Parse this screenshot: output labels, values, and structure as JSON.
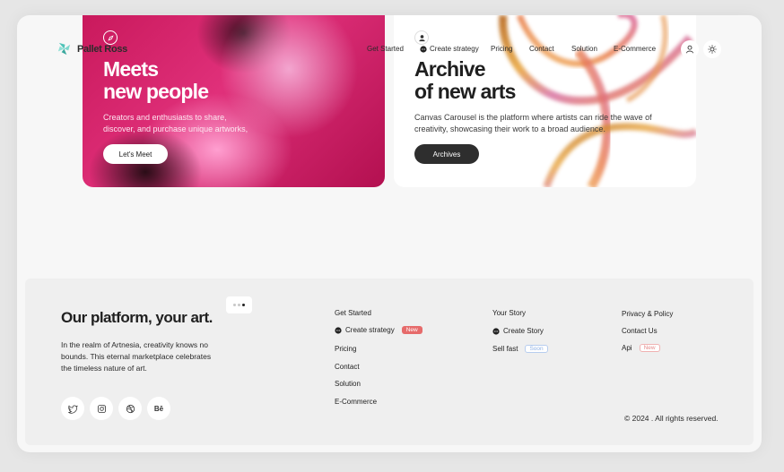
{
  "brand": {
    "name": "Pallet Ross"
  },
  "nav": {
    "links": [
      "Get Started",
      "Create strategy",
      "Pricing",
      "Contact",
      "Solution",
      "E-Commerce"
    ]
  },
  "cards": [
    {
      "title_line1": "Meets",
      "title_line2": "new people",
      "description": "Creators and enthusiasts to share, discover, and purchase unique artworks,",
      "button": "Let's Meet"
    },
    {
      "title_line1": "Archive",
      "title_line2": "of new arts",
      "description": "Canvas Carousel is the platform where artists can ride the wave of creativity, showcasing their work to a broad audience.",
      "button": "Archives"
    }
  ],
  "footer": {
    "title": "Our platform, your art.",
    "description": "In the realm of Artnesia, creativity knows no bounds. This eternal marketplace celebrates the timeless nature of art.",
    "col1": {
      "get_started": "Get Started",
      "create_strategy": "Create strategy",
      "create_strategy_badge": "New",
      "pricing": "Pricing",
      "contact": "Contact",
      "solution": "Solution",
      "ecommerce": "E-Commerce"
    },
    "col2": {
      "your_story": "Your Story",
      "create_story": "Create Story",
      "sell_fast": "Sell fast",
      "sell_fast_badge": "Soon"
    },
    "col3": {
      "privacy": "Privacy & Policy",
      "contact_us": "Contact Us",
      "api": "Api",
      "api_badge": "New"
    },
    "social_icons": [
      "twitter-icon",
      "instagram-icon",
      "dribbble-icon",
      "behance-icon"
    ],
    "copyright": "© 2024 . All rights reserved."
  },
  "colors": {
    "accent_teal": "#4fc3b8",
    "badge_red": "#e66b6b",
    "dark_button": "#2e2e2e",
    "card_pink": "#d42468"
  }
}
